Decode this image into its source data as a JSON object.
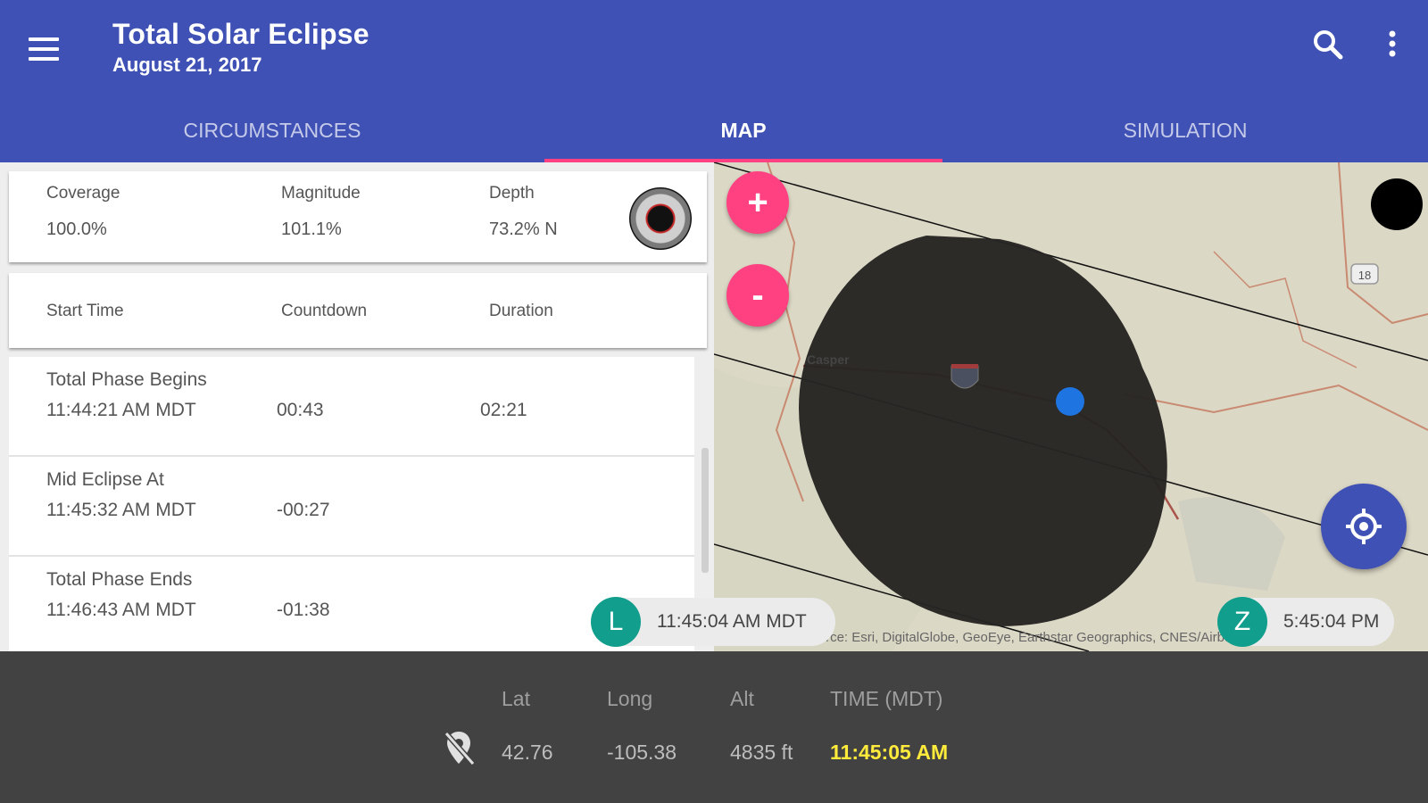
{
  "header": {
    "title": "Total Solar Eclipse",
    "subtitle": "August 21, 2017",
    "menu_icon": "menu-icon",
    "search_icon": "search-icon",
    "more_icon": "more-vert-icon",
    "background": "#3f51b5",
    "accent": "#ff4081"
  },
  "tabs": [
    {
      "label": "CIRCUMSTANCES",
      "active": false
    },
    {
      "label": "MAP",
      "active": true
    },
    {
      "label": "SIMULATION",
      "active": false
    }
  ],
  "coverage_card": {
    "coverage_label": "Coverage",
    "coverage_value": "100.0%",
    "magnitude_label": "Magnitude",
    "magnitude_value": "101.1%",
    "depth_label": "Depth",
    "depth_value": "73.2% N"
  },
  "phases_header": {
    "start_label": "Start Time",
    "countdown_label": "Countdown",
    "duration_label": "Duration"
  },
  "phases": [
    {
      "title": "Total Phase Begins",
      "time": "11:44:21 AM MDT",
      "countdown": "00:43",
      "duration": "02:21"
    },
    {
      "title": "Mid Eclipse At",
      "time": "11:45:32 AM MDT",
      "countdown": "-00:27",
      "duration": ""
    },
    {
      "title": "Total Phase Ends",
      "time": "11:46:43 AM MDT",
      "countdown": "-01:38",
      "duration": ""
    }
  ],
  "map": {
    "zoom_in": "+",
    "zoom_out": "-",
    "city_label": "Casper",
    "route_label": "18",
    "attribution": "© Esri — Source: Esri, DigitalGlobe, GeoEye, Earthstar Geographics, CNES/Airbus DS, USDA, USGS",
    "shadow_color": "#262523",
    "location_color": "#1e74e0"
  },
  "chips": {
    "local_letter": "L",
    "local_time": "11:45:04 AM MDT",
    "zulu_letter": "Z",
    "zulu_time": "5:45:04 PM"
  },
  "location_bar": {
    "lat_label": "Lat",
    "long_label": "Long",
    "alt_label": "Alt",
    "time_label": "TIME (MDT)",
    "lat_value": "42.76",
    "long_value": "-105.38",
    "alt_value": "4835 ft",
    "time_value": "11:45:05 AM",
    "time_color": "#ffeb3b"
  }
}
